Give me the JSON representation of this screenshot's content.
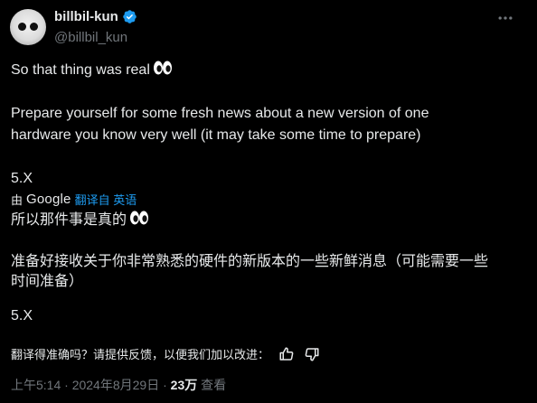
{
  "author": {
    "name": "billbil-kun",
    "handle": "@billbil_kun",
    "verified": true,
    "verified_color": "#1d9bf0"
  },
  "tweet": {
    "line1": "So that thing was real",
    "line2a": "Prepare yourself for some fresh news about a new version of one",
    "line2b": "hardware you know very well (it may take some time to prepare)",
    "line3": "5.X"
  },
  "translation_bar": {
    "prefix": "由",
    "provider": "Google",
    "link_text": "翻译自 英语"
  },
  "translation": {
    "line1": "所以那件事是真的",
    "line2a": "准备好接收关于你非常熟悉的硬件的新版本的一些新鲜消息（可能需要一些",
    "line2b": "时间准备）",
    "line3": "5.X"
  },
  "feedback": {
    "question": "翻译得准确吗？请提供反馈，以便我们加以改进："
  },
  "meta": {
    "time": "上午5:14",
    "date": "2024年8月29日",
    "views_count": "23万",
    "views_label": "查看",
    "separator": "·"
  },
  "icons": [
    "eyes-emoji-icon",
    "verified-badge-icon",
    "more-options-icon",
    "thumbs-up-icon",
    "thumbs-down-icon"
  ]
}
